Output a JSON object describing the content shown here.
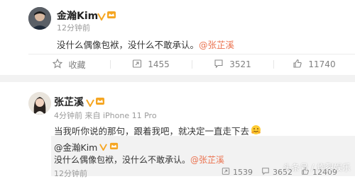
{
  "post1": {
    "author": "金瀚Kim",
    "time": "12分钟前",
    "text": "没什么偶像包袱，没什么不敢承认。",
    "mention": "@张芷溪",
    "actions": {
      "favorite": "收藏",
      "repost": "1455",
      "comment": "3521",
      "like": "11740"
    }
  },
  "post2": {
    "author": "张芷溪",
    "time": "4分钟前",
    "source": "来自 iPhone 11 Pro",
    "text": "当我听你说的那句，跟着我吧，就决定一直走下去",
    "quote": {
      "author": "@金瀚Kim",
      "text": "没什么偶像包袱，没什么不敢承认。",
      "mention": "@张芷溪",
      "time": "12分钟前",
      "actions": {
        "repost": "1539",
        "comment": "3652",
        "like": "12409"
      }
    }
  },
  "watermark": "头条号 / 炸裂娱乐",
  "colors": {
    "mention": "#eb7350",
    "badge": "#f5a623",
    "heart": "#e8413b"
  }
}
